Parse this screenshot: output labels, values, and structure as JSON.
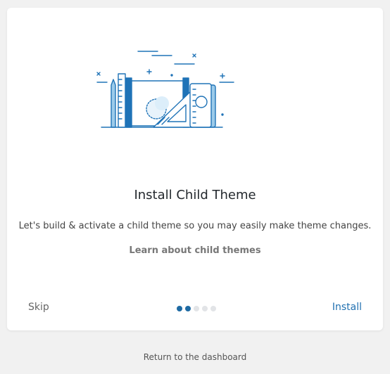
{
  "card": {
    "title": "Install Child Theme",
    "description": "Let's build & activate a child theme so you may easily make theme changes.",
    "learn_link": "Learn about child themes",
    "skip_label": "Skip",
    "install_label": "Install",
    "illustration_icon": "design-tools-illustration",
    "pagination": {
      "total_steps": 5,
      "current_steps": [
        1,
        2
      ]
    }
  },
  "footer": {
    "return_link": "Return to the dashboard"
  },
  "colors": {
    "accent": "#2271b1",
    "dot_active": "#1e6aa3",
    "dot_inactive": "#e2e4e7",
    "background": "#f1f1f1",
    "illustration_blue": "#1f73b7",
    "illustration_light": "#9ccbea"
  }
}
